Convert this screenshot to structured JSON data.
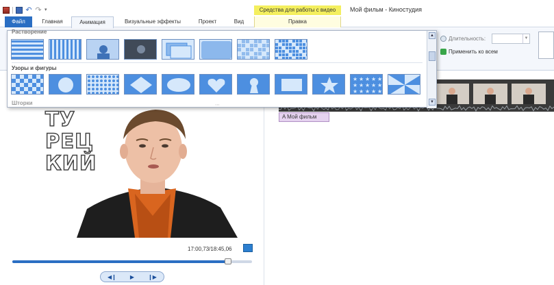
{
  "titlebar": {
    "window_title": "Мой фильм - Киностудия",
    "context_tab_header": "Средства для работы с видео"
  },
  "quick_access": {
    "icons": [
      "app-menu-icon",
      "save-icon",
      "undo-icon",
      "redo-icon",
      "customize-dropdown-icon"
    ]
  },
  "tabs": {
    "file": "Файл",
    "home": "Главная",
    "animation": "Анимация",
    "visual_effects": "Визуальные эффекты",
    "project": "Проект",
    "view": "Вид",
    "edit": "Правка",
    "active": "Анимация"
  },
  "ribbon": {
    "duration_label": "Длительность:",
    "duration_value": "",
    "apply_all_label": "Применить ко всем"
  },
  "gallery": {
    "section_cut": "Растворение",
    "section_patterns": "Узоры и фигуры",
    "section_cut2": "Шторки",
    "row1": [
      "horizontal-bars",
      "vertical-bars",
      "dissolve-fade",
      "fade-dark",
      "cross-fade",
      "blur",
      "pixelate-soft",
      "pixelate"
    ],
    "row2": [
      "checkerboard",
      "circle",
      "dots-grid",
      "diamond",
      "ellipse",
      "heart",
      "keyhole",
      "rectangle",
      "star",
      "stars-grid",
      "pinwheel"
    ]
  },
  "player": {
    "timecode": "17:00,73/18:45,06",
    "progress": 0.9,
    "caption_lines": [
      "ТУ",
      "РЕЦ",
      "КИЙ"
    ]
  },
  "storyboard": {
    "title_clip_label": "Мой фильм"
  },
  "colors": {
    "file_tab": "#2a6ec3",
    "context_tab": "#f4ef5e",
    "title_clip": "#e5d2ef"
  }
}
